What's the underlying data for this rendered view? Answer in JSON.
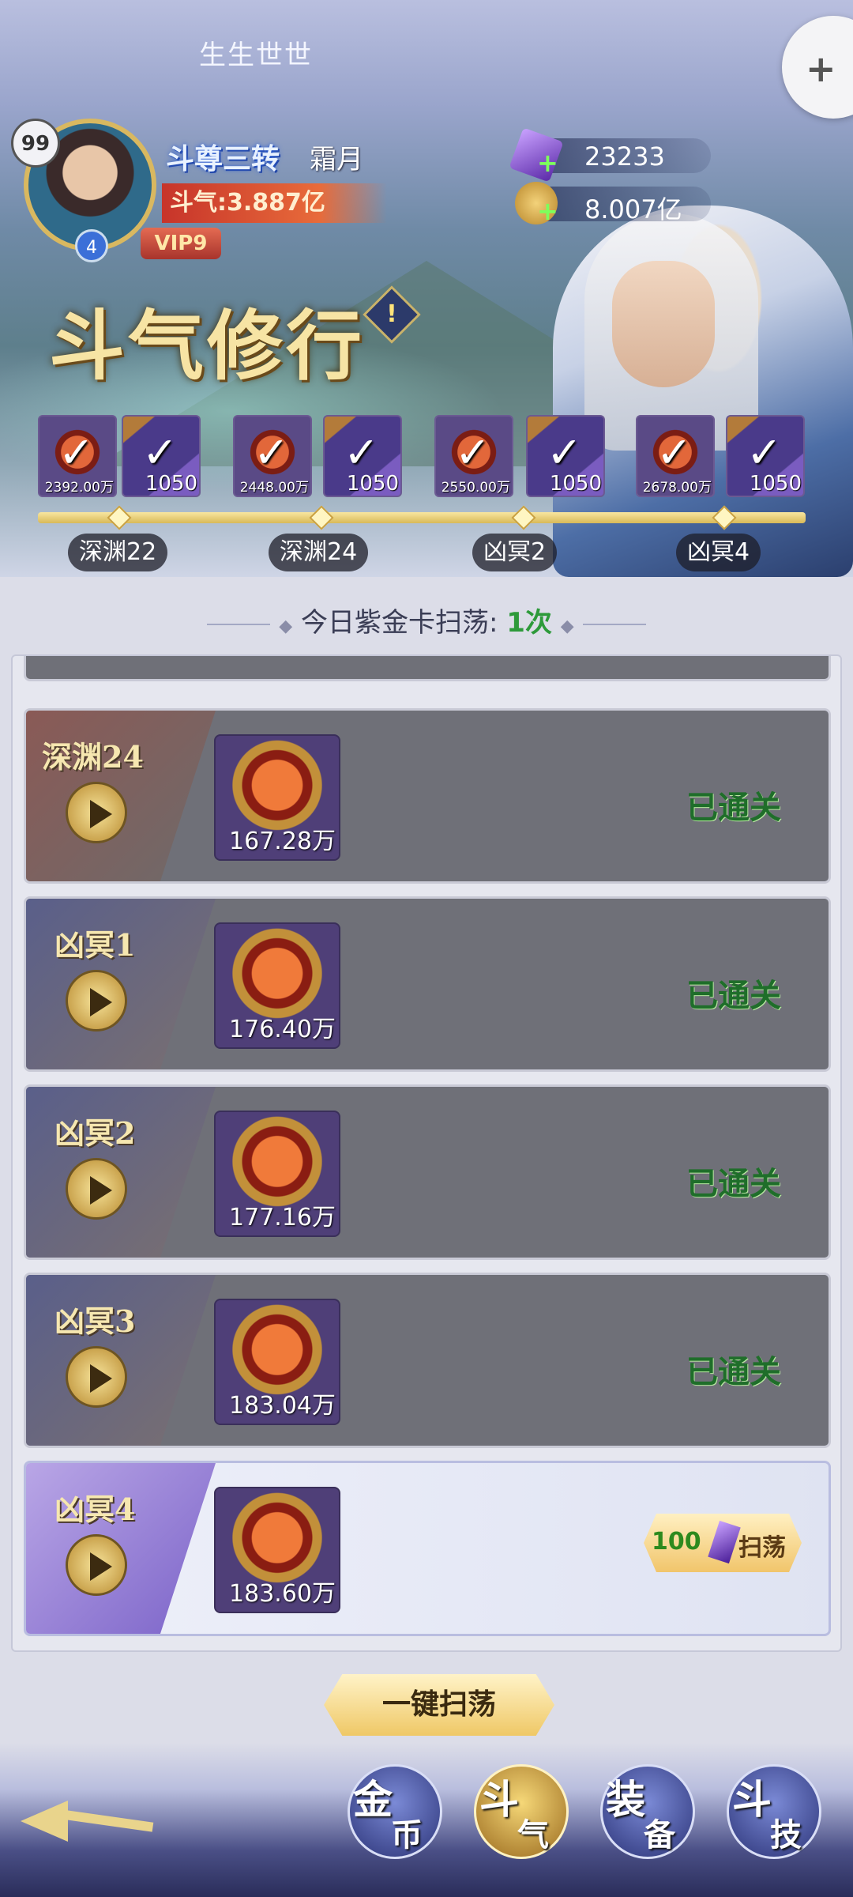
{
  "app_title": "生生世世",
  "player": {
    "level": "99",
    "stars": "4",
    "vip": "VIP9",
    "title": "斗尊三转",
    "name": "霜月",
    "power": "斗气:3.887亿"
  },
  "resources": {
    "gems": "23233",
    "gold": "8.007亿"
  },
  "section_title": "斗气修行",
  "info_icon": "!",
  "milestones": [
    {
      "orb_amount": "2392.00万",
      "crystal_amount": "1050",
      "stage": "深渊22"
    },
    {
      "orb_amount": "2448.00万",
      "crystal_amount": "1050",
      "stage": "深渊24"
    },
    {
      "orb_amount": "2550.00万",
      "crystal_amount": "1050",
      "stage": "凶冥2"
    },
    {
      "orb_amount": "2678.00万",
      "crystal_amount": "1050",
      "stage": "凶冥4"
    }
  ],
  "sweep_info": {
    "label": "今日紫金卡扫荡:",
    "count": "1次"
  },
  "stages": [
    {
      "name": "深渊24",
      "reward": "167.28万",
      "status": "已通关"
    },
    {
      "name": "凶冥1",
      "reward": "176.40万",
      "status": "已通关"
    },
    {
      "name": "凶冥2",
      "reward": "177.16万",
      "status": "已通关"
    },
    {
      "name": "凶冥3",
      "reward": "183.04万",
      "status": "已通关"
    },
    {
      "name": "凶冥4",
      "reward": "183.60万",
      "sweep_cost": "100",
      "sweep_label": "扫荡"
    }
  ],
  "one_key_sweep": "一键扫荡",
  "nav": [
    {
      "c1": "金",
      "c2": "币"
    },
    {
      "c1": "斗",
      "c2": "气"
    },
    {
      "c1": "装",
      "c2": "备"
    },
    {
      "c1": "斗",
      "c2": "技"
    }
  ],
  "icons": {
    "check": "✓",
    "float": "+"
  }
}
